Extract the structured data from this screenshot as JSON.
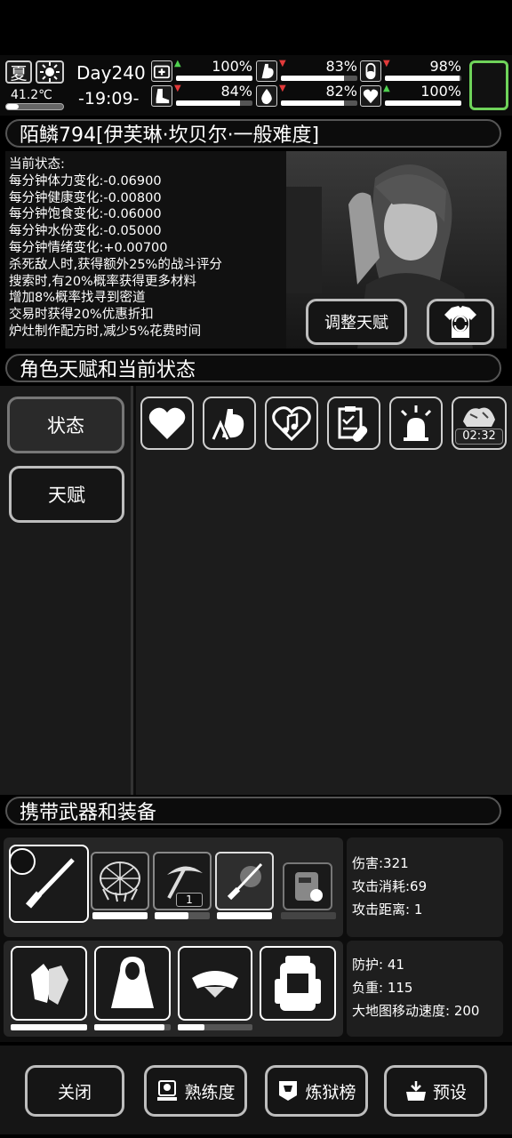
{
  "status_bar": {
    "season": "夏",
    "temperature": "41.2℃",
    "day": "Day240",
    "time": "-19:09-",
    "stats": [
      {
        "icon": "medkit-icon",
        "trend": "up",
        "value": "100%",
        "fill": 1.0
      },
      {
        "icon": "stomach-icon",
        "trend": "down",
        "value": "83%",
        "fill": 0.83
      },
      {
        "icon": "pill-icon",
        "trend": "down",
        "value": "98%",
        "fill": 0.98
      },
      {
        "icon": "boot-icon",
        "trend": "down",
        "value": "84%",
        "fill": 0.84
      },
      {
        "icon": "water-drop-icon",
        "trend": "down",
        "value": "82%",
        "fill": 0.82
      },
      {
        "icon": "heart-icon",
        "trend": "up",
        "value": "100%",
        "fill": 1.0
      }
    ]
  },
  "character": {
    "name": "陌鳞794[伊芙琳·坎贝尔·一般难度]",
    "status_lines": [
      "当前状态:",
      "每分钟体力变化:-0.06900",
      "每分钟健康变化:-0.00800",
      "每分钟饱食变化:-0.06000",
      "每分钟水份变化:-0.05000",
      "每分钟情绪变化:+0.00700",
      "杀死敌人时,获得额外25%的战斗评分",
      "搜索时,有20%概率获得更多材料",
      "增加8%概率找寻到密道",
      "交易时获得20%优惠折扣",
      "炉灶制作配方时,减少5%花费时间"
    ],
    "adjust_talent_button": "调整天赋"
  },
  "talent_section": {
    "title": "角色天赋和当前状态",
    "tabs": [
      {
        "label": "状态"
      },
      {
        "label": "天赋"
      }
    ],
    "status_icons": [
      "heart-icon",
      "stomach-arrows-icon",
      "music-heart-icon",
      "clipboard-pill-icon",
      "alarm-light-icon",
      "clothes-pile-icon"
    ],
    "timer": "02:32"
  },
  "equipment_section": {
    "title": "携带武器和装备",
    "weapon_stats": [
      "伤害:321",
      "攻击消耗:69",
      "攻击距离: 1"
    ],
    "weapon_slot_count": "1",
    "armor_stats": [
      "防护: 41",
      "负重: 115",
      "大地图移动速度: 200"
    ]
  },
  "footer": {
    "buttons": [
      {
        "label": "关闭"
      },
      {
        "label": "熟练度"
      },
      {
        "label": "炼狱榜"
      },
      {
        "label": "预设"
      }
    ]
  }
}
